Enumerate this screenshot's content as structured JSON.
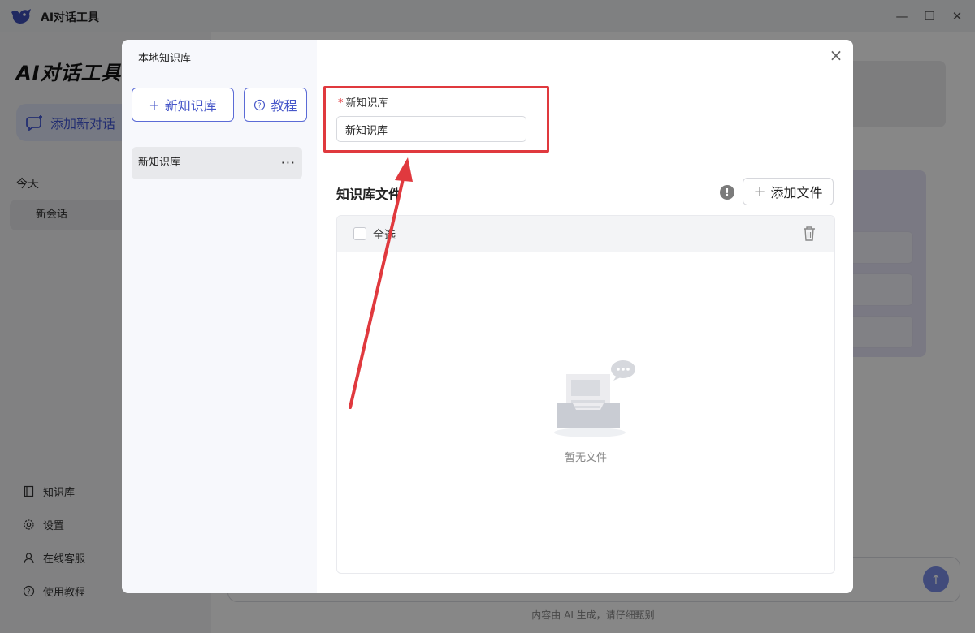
{
  "window": {
    "title": "AI对话工具",
    "controls": [
      "minimize",
      "maximize",
      "close"
    ]
  },
  "sidebar": {
    "brand": "AI对话工具",
    "new_chat_label": "添加新对话",
    "section_today": "今天",
    "conversations": [
      "新会话"
    ],
    "bottom_links": [
      "知识库",
      "设置",
      "在线客服",
      "使用教程"
    ]
  },
  "main": {
    "footer_note": "内容由 AI 生成，请仔细甄别",
    "send_icon": "arrow-up-icon"
  },
  "modal": {
    "title": "本地知识库",
    "new_kb_label": "新知识库",
    "tutorial_label": "教程",
    "kb_list": [
      {
        "name": "新知识库",
        "more": "···"
      }
    ],
    "field": {
      "label": "新知识库",
      "value": "新知识库",
      "required": true
    },
    "files": {
      "title": "知识库文件",
      "add_label": "添加文件",
      "select_all": "全选",
      "empty_text": "暂无文件"
    },
    "colors": {
      "accent": "#4757c9",
      "annotation": "#e0393e"
    }
  }
}
